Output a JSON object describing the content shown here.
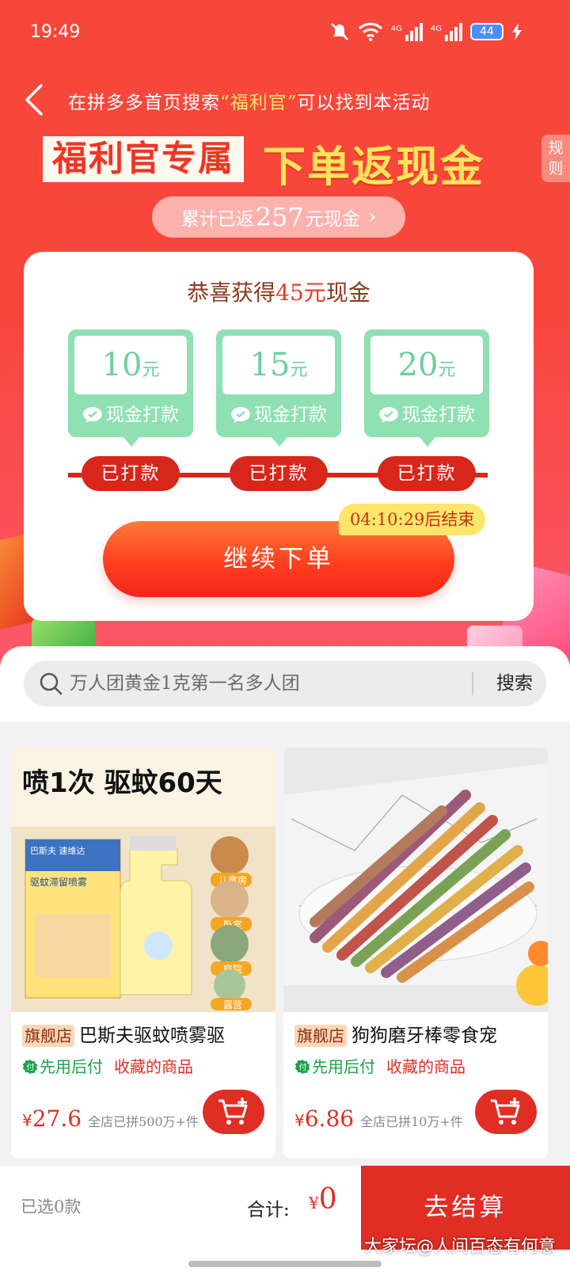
{
  "status_bar": {
    "time": "19:49",
    "battery": "44",
    "network_1": "4G",
    "network_2": "4G"
  },
  "nav": {
    "hint_prefix": "在拼多多首页搜索",
    "hint_keyword": "“福利官”",
    "hint_suffix": "可以找到本活动"
  },
  "banner": {
    "left": "福利官专属",
    "right": "下单返现金",
    "rules_button": "规则"
  },
  "returned": {
    "prefix": "累计已返",
    "amount": "257",
    "suffix": "元现金"
  },
  "reward_card": {
    "title_prefix": "恭喜获得",
    "title_amount": "45元",
    "title_suffix": "现金",
    "tiers": [
      {
        "value": "10",
        "unit": "元",
        "label": "现金打款",
        "status": "已打款"
      },
      {
        "value": "15",
        "unit": "元",
        "label": "现金打款",
        "status": "已打款"
      },
      {
        "value": "20",
        "unit": "元",
        "label": "现金打款",
        "status": "已打款"
      }
    ],
    "countdown": "04:10:29后结束",
    "continue_button": "继续下单"
  },
  "search": {
    "placeholder": "万人团黄金1克第一名多人团",
    "button": "搜索"
  },
  "products": [
    {
      "badge": "旗舰店",
      "title": "巴斯夫驱蚊喷雾驱",
      "tag_green": "先用后付",
      "tag_red": "收藏的商品",
      "currency": "¥",
      "price": "27.6",
      "sold": "全店已拼500万+件",
      "image": {
        "headline": "喷1次 驱蚊60天",
        "brand": "巴斯夫 速维达",
        "product_name": "驱蚊滞留喷雾",
        "rooms": [
          "儿童房",
          "卧室",
          "庭院",
          "露营"
        ]
      }
    },
    {
      "badge": "旗舰店",
      "title": "狗狗磨牙棒零食宠",
      "tag_green": "先用后付",
      "tag_red": "收藏的商品",
      "currency": "¥",
      "price": "6.86",
      "sold": "全店已拼10万+件"
    }
  ],
  "bottom_bar": {
    "selected": "已选0款",
    "total_label": "合计:",
    "currency": "¥",
    "total": "0",
    "checkout": "去结算"
  },
  "watermark": "大家坛@人间百态有何意",
  "colors": {
    "brand_red": "#e02e24",
    "hero_red": "#f7473a",
    "tier_green": "#8fe0b2",
    "countdown_yellow": "#fde66a"
  }
}
